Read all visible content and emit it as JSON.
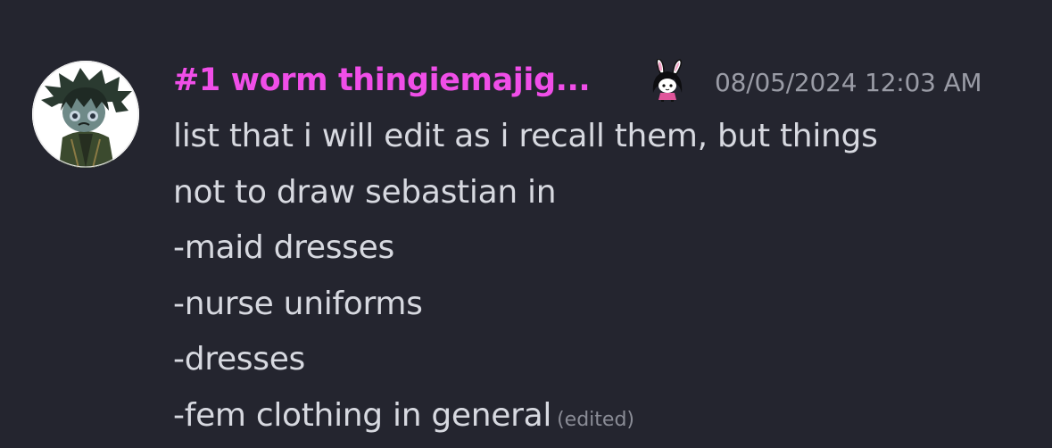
{
  "message": {
    "author": {
      "display_name": "#1 worm thingiemajig...",
      "name_color": "#f04ee8"
    },
    "role_icon": "bunny-eared-girl-icon",
    "timestamp": "08/05/2024 12:03 AM",
    "content_lines": [
      "list that i will edit as i recall them, but things",
      "not to draw sebastian in",
      "-maid dresses",
      "-nurse uniforms",
      "-dresses",
      "-fem clothing in general"
    ],
    "edited_label": "(edited)"
  }
}
